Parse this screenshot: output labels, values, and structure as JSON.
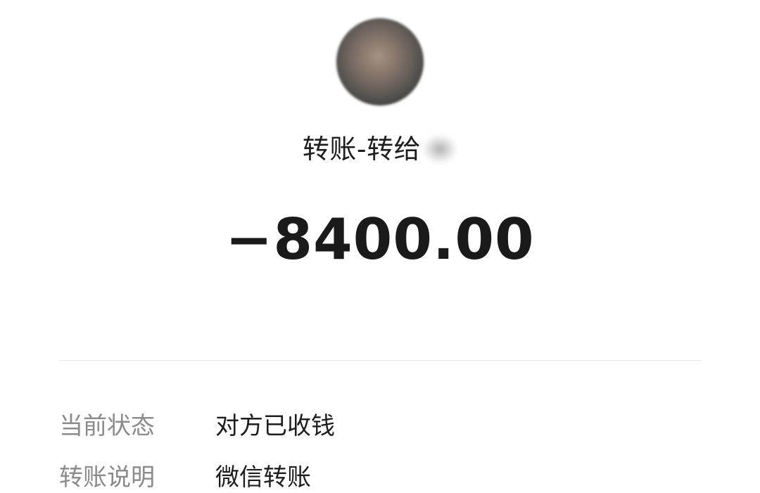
{
  "payee": {
    "avatar_icon": "user-avatar",
    "title_prefix": "转账-转给"
  },
  "amount": "−8400.00",
  "details": [
    {
      "label": "当前状态",
      "value": "对方已收钱"
    },
    {
      "label": "转账说明",
      "value": "微信转账"
    }
  ],
  "colors": {
    "background": "#ffffff",
    "primary_text": "#1a1a1a",
    "label_text": "#8b8b8b",
    "divider": "#e8e8e8"
  }
}
